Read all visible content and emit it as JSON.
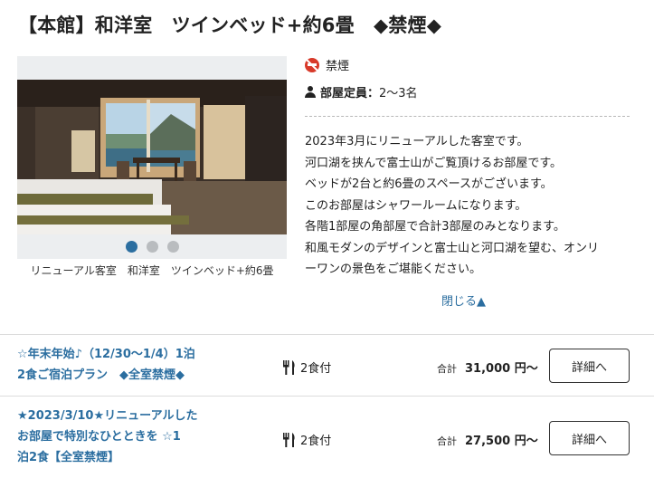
{
  "room": {
    "title": "【本館】和洋室　ツインベッド+約6畳　◆禁煙◆",
    "smoking": "禁煙",
    "capacity_label": "部屋定員：",
    "capacity_value": "2～3名",
    "photo_caption": "リニューアル客室　和洋室　ツインベッド+約6畳",
    "gallery_dots": 3,
    "gallery_active_index": 0,
    "description": [
      "2023年3月にリニューアルした客室です。",
      "河口湖を挟んで富士山がご覧頂けるお部屋です。",
      "ベッドが2台と約6畳のスペースがございます。",
      "このお部屋はシャワールームになります。",
      "各階1部屋の角部屋で合計3部屋のみとなります。",
      "和風モダンのデザインと富士山と河口湖を望む、オンリ",
      "ーワンの景色をご堪能ください。"
    ],
    "close_link": "閉じる▲"
  },
  "plans": [
    {
      "title_lines": [
        "☆年末年始♪（12/30～1/4）1泊",
        "2食ご宿泊プラン　◆全室禁煙◆"
      ],
      "meal": "2食付",
      "price_label": "合計",
      "price": "31,000 円～",
      "detail_button": "詳細へ"
    },
    {
      "title_lines": [
        "★2023/3/10★リニューアルした",
        "お部屋で特別なひとときを ☆1",
        "泊2食【全室禁煙】"
      ],
      "meal": "2食付",
      "price_label": "合計",
      "price": "27,500 円～",
      "detail_button": "詳細へ"
    }
  ],
  "colors": {
    "accent": "#2b6ea0",
    "no_smoking_icon": "#d83a2a",
    "gallery_bg": "#eceef0",
    "dot_inactive": "#b9bcbf"
  }
}
